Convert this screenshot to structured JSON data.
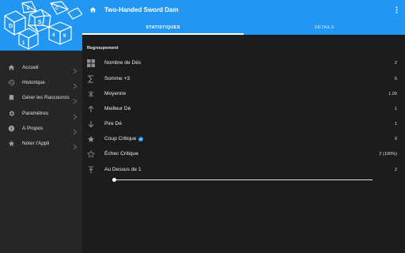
{
  "app": {
    "title": "Two-Handed Sword Dam",
    "accent_color": "#2196f3"
  },
  "tabs": [
    {
      "label": "STATISTIQUES",
      "active": true
    },
    {
      "label": "DÉTAILS",
      "active": false
    }
  ],
  "drawer": {
    "items": [
      {
        "label": "Accueil",
        "icon": "home-icon"
      },
      {
        "label": "Historique",
        "icon": "history-icon"
      },
      {
        "label": "Gérer les Raccourcis",
        "icon": "bookmark-icon"
      },
      {
        "label": "Paramètres",
        "icon": "gear-icon"
      },
      {
        "label": "À Propos",
        "icon": "info-icon"
      },
      {
        "label": "Noter l'Appli",
        "icon": "star-icon"
      }
    ]
  },
  "stats": {
    "section_title": "Regroupement",
    "rows": [
      {
        "label": "Nombre de Dés",
        "value": "2",
        "icon": "grid-icon"
      },
      {
        "label": "Somme +3",
        "value": "5",
        "icon": "sigma-icon"
      },
      {
        "label": "Moyenne",
        "value": "1.00",
        "icon": "average-icon"
      },
      {
        "label": "Meilleur Dé",
        "value": "1",
        "icon": "arrow-up-icon"
      },
      {
        "label": "Pire Dé",
        "value": "1",
        "icon": "arrow-down-icon"
      },
      {
        "label": "Coup Critique",
        "value": "0",
        "icon": "star-filled-icon",
        "has_info": true
      },
      {
        "label": "Échec Critique",
        "value": "2 (100%)",
        "icon": "star-outline-icon"
      },
      {
        "label": "Au Dessus de 1",
        "value": "2",
        "icon": "above-threshold-icon"
      }
    ],
    "threshold_slider": {
      "value": 1
    }
  }
}
